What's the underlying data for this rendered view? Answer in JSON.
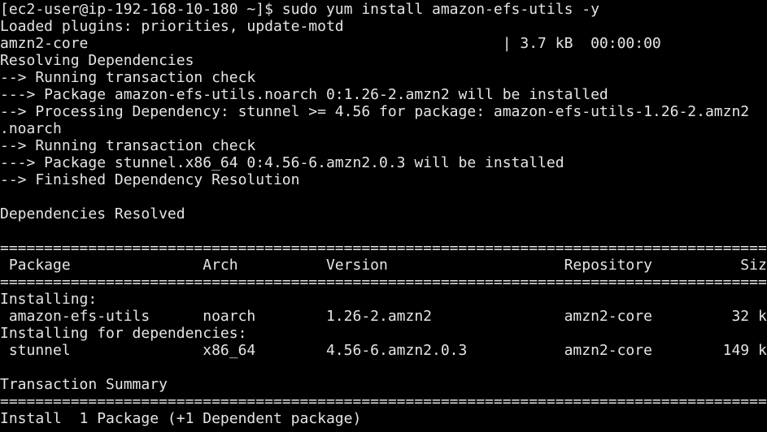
{
  "terminal": {
    "background": "#000000",
    "foreground": "#e5e5e5",
    "lines": [
      "[ec2-user@ip-192-168-10-180 ~]$ sudo yum install amazon-efs-utils -y",
      "Loaded plugins: priorities, update-motd",
      "amzn2-core                                               | 3.7 kB  00:00:00",
      "Resolving Dependencies",
      "--> Running transaction check",
      "---> Package amazon-efs-utils.noarch 0:1.26-2.amzn2 will be installed",
      "--> Processing Dependency: stunnel >= 4.56 for package: amazon-efs-utils-1.26-2.amzn2",
      ".noarch",
      "--> Running transaction check",
      "---> Package stunnel.x86_64 0:4.56-6.amzn2.0.3 will be installed",
      "--> Finished Dependency Resolution",
      "",
      "Dependencies Resolved",
      "",
      "=============================================================================================",
      " Package               Arch          Version                    Repository          Size",
      "=============================================================================================",
      "Installing:",
      " amazon-efs-utils      noarch        1.26-2.amzn2               amzn2-core         32 k",
      "Installing for dependencies:",
      " stunnel               x86_64        4.56-6.amzn2.0.3           amzn2-core        149 k",
      "",
      "Transaction Summary",
      "=============================================================================================",
      "Install  1 Package (+1 Dependent package)"
    ]
  }
}
